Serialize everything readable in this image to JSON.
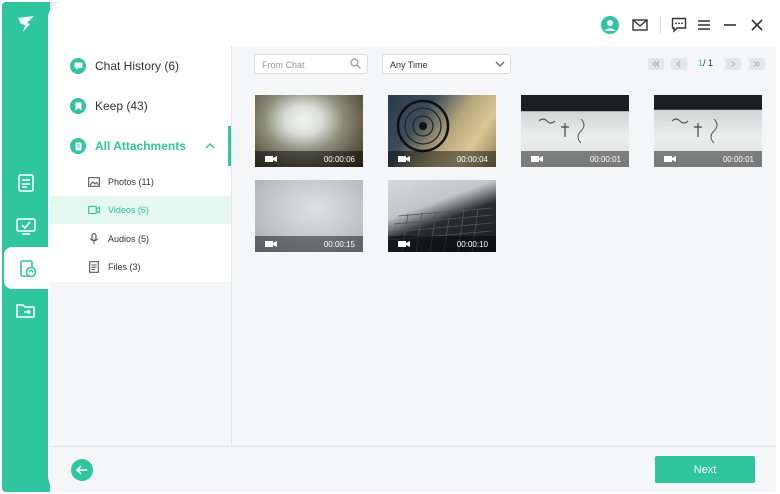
{
  "brand_color": "#2fc59f",
  "sidebar": {
    "main_items": [
      {
        "label": "Chat History (6)",
        "icon": "chat-bubble-icon"
      },
      {
        "label": "Keep (43)",
        "icon": "bookmark-icon"
      },
      {
        "label": "All Attachments",
        "icon": "attachment-icon",
        "expanded": true
      }
    ],
    "sub_items": [
      {
        "label": "Photos (11)",
        "icon": "photo-icon"
      },
      {
        "label": "Videos (6)",
        "icon": "video-icon",
        "selected": true
      },
      {
        "label": "Audios (5)",
        "icon": "microphone-icon"
      },
      {
        "label": "Files (3)",
        "icon": "file-icon"
      }
    ]
  },
  "toolbar": {
    "search_placeholder": "From Chat",
    "time_filter": "Any Time",
    "page_current": "1",
    "page_total": "/ 1"
  },
  "videos": [
    {
      "duration": "00:00:06"
    },
    {
      "duration": "00:00:04"
    },
    {
      "duration": "00:00:01"
    },
    {
      "duration": "00:00:01"
    },
    {
      "duration": "00:00:15"
    },
    {
      "duration": "00:00:10"
    }
  ],
  "footer": {
    "next_label": "Next"
  }
}
